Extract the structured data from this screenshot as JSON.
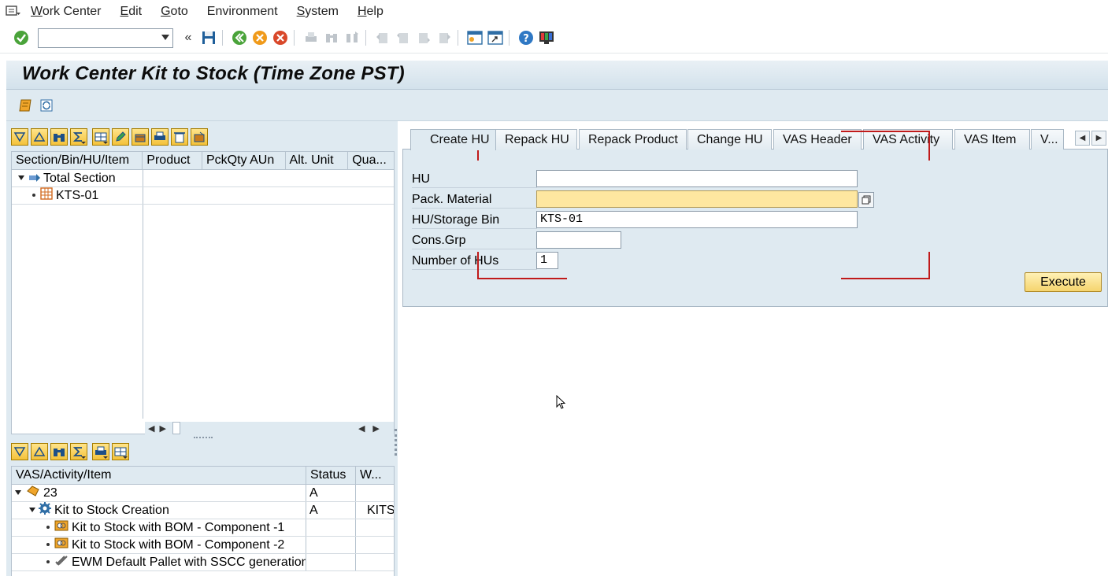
{
  "menubar": {
    "items": [
      {
        "label": "Work Center",
        "underline": "W",
        "rest": "ork Center"
      },
      {
        "label": "Edit",
        "underline": "E",
        "rest": "dit"
      },
      {
        "label": "Goto",
        "underline": "G",
        "rest": "oto"
      },
      {
        "label": "Environment",
        "underline": "",
        "rest": "Environment"
      },
      {
        "label": "System",
        "underline": "S",
        "rest": "ystem"
      },
      {
        "label": "Help",
        "underline": "H",
        "rest": "elp"
      }
    ]
  },
  "toolbar": {
    "command_field": "",
    "icons": [
      "enter-icon",
      "save-icon",
      "back-icon",
      "exit-icon",
      "cancel-icon",
      "print-icon",
      "find-icon",
      "find-next-icon",
      "first-page-icon",
      "previous-page-icon",
      "next-page-icon",
      "last-page-icon",
      "new-session-icon",
      "shortcut-icon",
      "help-icon",
      "layout-icon"
    ]
  },
  "title": "Work Center Kit to Stock (Time Zone PST)",
  "top_grid": {
    "columns": [
      "Section/Bin/HU/Item",
      "Product",
      "PckQty AUn",
      "Alt. Unit",
      "Qua..."
    ],
    "rows": [
      {
        "label": "Total Section",
        "icon": "section-icon"
      },
      {
        "label": "KTS-01",
        "icon": "bin-icon"
      }
    ]
  },
  "bottom_grid": {
    "columns": [
      "VAS/Activity/Item",
      "Status",
      "W..."
    ],
    "rows": [
      {
        "label": "23",
        "status": "A",
        "w": "",
        "icon": "vas-order-icon"
      },
      {
        "label": "Kit to Stock Creation",
        "status": "A",
        "w": "KITS",
        "icon": "activity-icon"
      },
      {
        "label": "Kit to Stock with BOM - Component -1",
        "status": "",
        "w": "",
        "icon": "component-icon"
      },
      {
        "label": "Kit to Stock with BOM - Component -2",
        "status": "",
        "w": "",
        "icon": "component-icon"
      },
      {
        "label": "EWM Default Pallet with SSCC generation",
        "status": "",
        "w": "",
        "icon": "pallet-icon"
      }
    ]
  },
  "tabs": [
    "Create HU",
    "Repack HU",
    "Repack Product",
    "Change HU",
    "VAS Header",
    "VAS Activity",
    "VAS Item",
    "V..."
  ],
  "form": {
    "hu_label": "HU",
    "hu_value": "",
    "pack_material_label": "Pack. Material",
    "pack_material_value": "",
    "storage_bin_label": "HU/Storage Bin",
    "storage_bin_value": "KTS-01",
    "cons_grp_label": "Cons.Grp",
    "cons_grp_value": "",
    "num_hus_label": "Number of HUs",
    "num_hus_value": "1",
    "execute_label": "Execute"
  },
  "colors": {
    "panel_bg": "#dfeaf1",
    "required_field": "#fee7a0",
    "button_yellow": "#f5d46e",
    "annotation_red": "#c01a1a"
  }
}
